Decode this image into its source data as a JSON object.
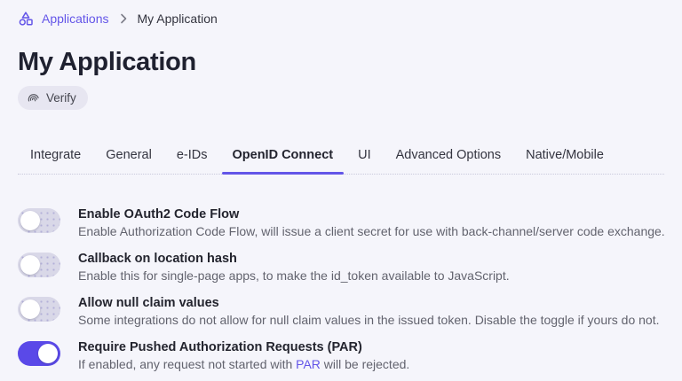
{
  "breadcrumb": {
    "root_label": "Applications",
    "current_label": "My Application"
  },
  "header": {
    "title": "My Application",
    "verify_label": "Verify"
  },
  "tabs": {
    "active": "OpenID Connect",
    "items": [
      {
        "label": "Integrate"
      },
      {
        "label": "General"
      },
      {
        "label": "e-IDs"
      },
      {
        "label": "OpenID Connect"
      },
      {
        "label": "UI"
      },
      {
        "label": "Advanced Options"
      },
      {
        "label": "Native/Mobile"
      }
    ]
  },
  "settings": {
    "items": [
      {
        "title": "Enable OAuth2 Code Flow",
        "description": "Enable Authorization Code Flow, will issue a client secret for use with back-channel/server code exchange.",
        "enabled": false
      },
      {
        "title": "Callback on location hash",
        "description": "Enable this for single-page apps, to make the id_token available to JavaScript.",
        "enabled": false
      },
      {
        "title": "Allow null claim values",
        "description": "Some integrations do not allow for null claim values in the issued token. Disable the toggle if yours do not.",
        "enabled": false
      },
      {
        "title": "Require Pushed Authorization Requests (PAR)",
        "description_prefix": "If enabled, any request not started with ",
        "link_label": "PAR",
        "description_suffix": " will be rejected.",
        "enabled": true
      }
    ]
  },
  "colors": {
    "accent_purple": "#6355e8",
    "toggle_on": "#5a49e8",
    "background": "#f5f5fb",
    "text_dark": "#1f2130",
    "text_muted": "#62636e"
  },
  "icons": {
    "breadcrumb_icon": "shapes-icon",
    "separator_icon": "chevron-right-icon",
    "verify_icon": "fingerprint-icon"
  }
}
